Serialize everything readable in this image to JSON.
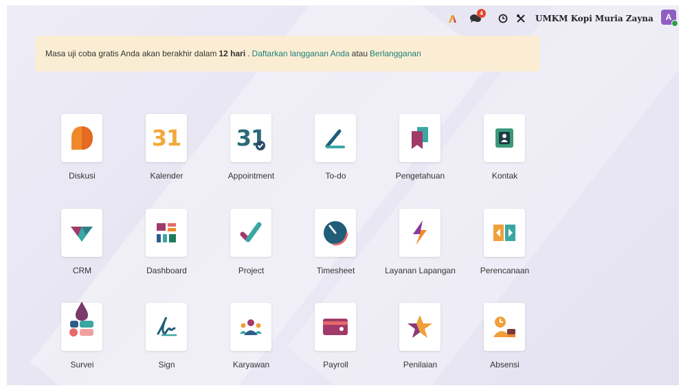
{
  "topbar": {
    "icons": [
      "activity-icon",
      "chat-icon",
      "clock-icon",
      "tools-icon"
    ],
    "message_count": "4",
    "company": "UMKM Kopi Muria Zayna",
    "avatar_initial": "A"
  },
  "trial_banner": {
    "text_before": "Masa uji coba gratis Anda akan berakhir dalam",
    "days": "12 hari",
    "dot": ".",
    "register_link": "Daftarkan langganan Anda",
    "or_text": "atau",
    "subscribe_link": "Berlangganan"
  },
  "apps": [
    {
      "label": "Diskusi",
      "icon": "discuss-icon"
    },
    {
      "label": "Kalender",
      "icon": "calendar-icon",
      "icon_text": "31"
    },
    {
      "label": "Appointment",
      "icon": "appointment-icon",
      "icon_text": "31"
    },
    {
      "label": "To-do",
      "icon": "todo-icon"
    },
    {
      "label": "Pengetahuan",
      "icon": "knowledge-icon"
    },
    {
      "label": "Kontak",
      "icon": "contacts-icon"
    },
    {
      "label": "CRM",
      "icon": "crm-icon"
    },
    {
      "label": "Dashboard",
      "icon": "dashboard-icon"
    },
    {
      "label": "Project",
      "icon": "project-icon"
    },
    {
      "label": "Timesheet",
      "icon": "timesheet-icon"
    },
    {
      "label": "Layanan Lapangan",
      "icon": "field-service-icon"
    },
    {
      "label": "Perencanaan",
      "icon": "planning-icon"
    },
    {
      "label": "Survei",
      "icon": "survey-icon"
    },
    {
      "label": "Sign",
      "icon": "sign-icon"
    },
    {
      "label": "Karyawan",
      "icon": "employees-icon"
    },
    {
      "label": "Payroll",
      "icon": "payroll-icon"
    },
    {
      "label": "Penilaian",
      "icon": "appraisal-icon"
    },
    {
      "label": "Absensi",
      "icon": "attendance-icon"
    }
  ],
  "colors": {
    "accent": "#1b7e7a",
    "banner": "#fbedd3",
    "badge": "#e0472e",
    "avatar": "#8e5fc0"
  }
}
